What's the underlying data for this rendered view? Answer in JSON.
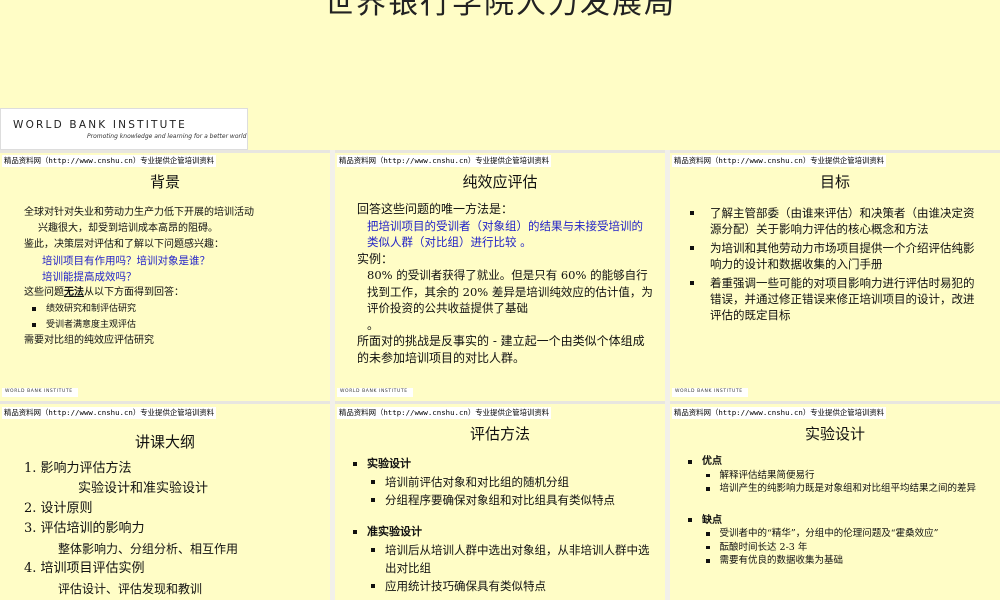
{
  "page_title": "世界银行学院人力发展局",
  "logo": {
    "name": "WORLD BANK INSTITUTE",
    "tagline": "Promoting knowledge and learning for a better world"
  },
  "stamp_text": "精品资料网（http://www.cnshu.cn）专业提供企管培训资料",
  "mini_logo_text": "WORLD BANK INSTITUTE",
  "slides": [
    {
      "title": "背景",
      "lines": [
        "全球对针对失业和劳动力生产力低下开展的培训活动",
        "兴趣很大，却受到培训成本高昂的阻碍。",
        "鉴此，决策层对评估和了解以下问题感兴趣：",
        "培训项目有作用吗？培训对象是谁？",
        "培训能提高成效吗？",
        "这些问题",
        "无法",
        "从以下方面得到回答：",
        "绩效研究和制评估研究",
        "受训者满意度主观评估",
        "需要对比组的纯效应评估研究"
      ]
    },
    {
      "title": "纯效应评估",
      "lines": [
        "回答这些问题的唯一方法是：",
        "把培训项目的受训者（对象组）的结果与未接受培训的类似人群（对比组）进行比较 。",
        "实例：",
        "80%  的受训者获得了就业。但是只有 60% 的能够自行找到工作，其余的 20% 差异是培训纯效应的估计值，为评价投资的公共收益提供了基础",
        "。",
        "所面对的挑战是反事实的 - 建立起一个由类似个体组成的未参加培训项目的对比人群。"
      ]
    },
    {
      "title": "目标",
      "items": [
        "了解主管部委（由谁来评估）和决策者（由谁决定资源分配）关于影响力评估的核心概念和方法",
        "为培训和其他劳动力市场项目提供一个介绍评估纯影响力的设计和数据收集的入门手册",
        "着重强调一些可能的对项目影响力进行评估时易犯的错误，并通过修正错误来修正培训项目的设计，改进评估的既定目标"
      ]
    },
    {
      "title": "讲课大纲",
      "lines": [
        "1.  影响力评估方法",
        "实验设计和准实验设计",
        "2.  设计原则",
        "3.  评估培训的影响力",
        "整体影响力、分组分析、相互作用",
        "4.  培训项目评估实例",
        "评估设计、评估发现和教训"
      ]
    },
    {
      "title": "评估方法",
      "sections": [
        {
          "heading": "实验设计",
          "items": [
            "培训前评估对象和对比组的随机分组",
            "分组程序要确保对象组和对比组具有类似特点"
          ]
        },
        {
          "heading": "准实验设计",
          "items": [
            "培训后从培训人群中选出对象组，从非培训人群中选出对比组",
            "应用统计技巧确保具有类似特点"
          ]
        }
      ]
    },
    {
      "title": "实验设计",
      "sections": [
        {
          "heading": "优点",
          "items": [
            "解释评估结果简便易行",
            "培训产生的纯影响力既是对象组和对比组平均结果之间的差异"
          ]
        },
        {
          "heading": "缺点",
          "items": [
            "受训者中的“精华”，分组中的伦理问题及“霍桑效应”",
            "酝酿时间长达 2-3 年",
            "需要有优良的数据收集为基础"
          ]
        }
      ]
    }
  ]
}
